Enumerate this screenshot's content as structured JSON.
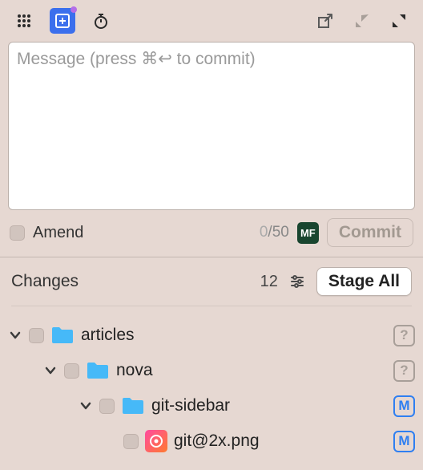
{
  "commit": {
    "placeholder": "Message (press ⌘↩ to commit)",
    "amend_label": "Amend",
    "count_current": "0",
    "count_max": "50",
    "avatar_initials": "MF",
    "commit_button": "Commit"
  },
  "changes": {
    "title": "Changes",
    "count": "12",
    "stage_all": "Stage All"
  },
  "tree": [
    {
      "label": "articles",
      "status": "?"
    },
    {
      "label": "nova",
      "status": "?"
    },
    {
      "label": "git-sidebar",
      "status": "M"
    },
    {
      "label": "git@2x.png",
      "status": "M"
    }
  ]
}
